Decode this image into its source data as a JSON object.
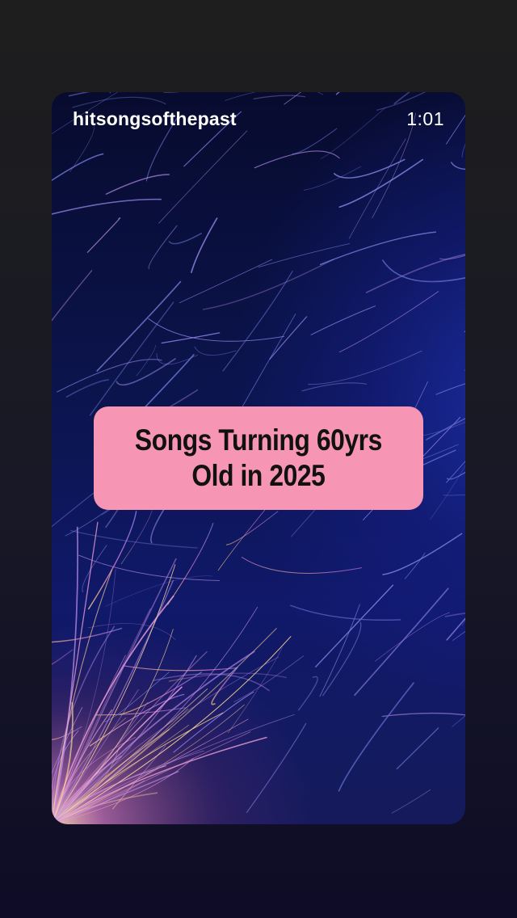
{
  "story": {
    "username": "hitsongsofthepast",
    "time_remaining": "1:01",
    "caption": {
      "line1": "Songs Turning 60yrs",
      "line2": "Old in 2025",
      "background_color": "#f795b5",
      "text_color": "#111111"
    },
    "background_image": "sparks-abstract-blue-purple"
  }
}
